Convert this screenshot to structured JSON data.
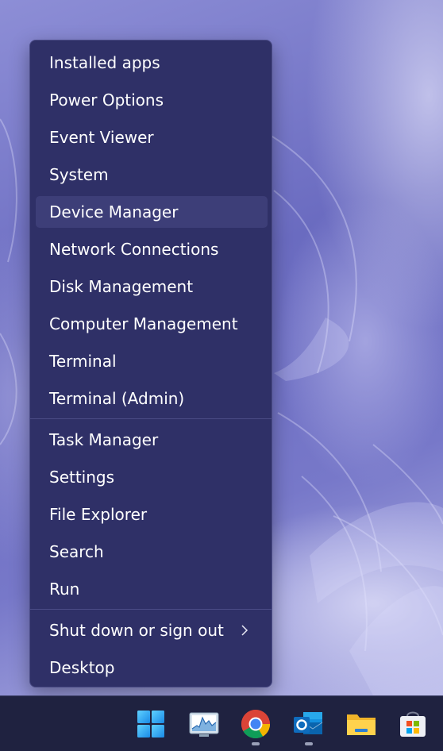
{
  "menu": {
    "items_group1": [
      {
        "label": "Installed apps"
      },
      {
        "label": "Power Options"
      },
      {
        "label": "Event Viewer"
      },
      {
        "label": "System"
      },
      {
        "label": "Device Manager"
      },
      {
        "label": "Network Connections"
      },
      {
        "label": "Disk Management"
      },
      {
        "label": "Computer Management"
      },
      {
        "label": "Terminal"
      },
      {
        "label": "Terminal (Admin)"
      }
    ],
    "items_group2": [
      {
        "label": "Task Manager"
      },
      {
        "label": "Settings"
      },
      {
        "label": "File Explorer"
      },
      {
        "label": "Search"
      },
      {
        "label": "Run"
      }
    ],
    "items_group3": [
      {
        "label": "Shut down or sign out",
        "icon": "chevron-right-icon"
      },
      {
        "label": "Desktop"
      }
    ],
    "highlighted": "Device Manager"
  },
  "taskbar": {
    "icons": [
      "windows-start-icon",
      "performance-monitor-icon",
      "chrome-icon",
      "outlook-icon",
      "file-explorer-icon",
      "microsoft-store-icon"
    ],
    "running": [
      "chrome-icon",
      "outlook-icon"
    ]
  },
  "colors": {
    "menu_bg": "#2f3067",
    "menu_hover": "#3d3e78",
    "taskbar_bg": "#1f2240",
    "text": "#ffffff"
  }
}
